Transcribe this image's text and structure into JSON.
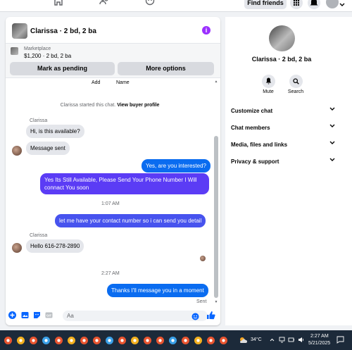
{
  "nav": {
    "find_friends": "Find friends"
  },
  "chat": {
    "title": "Clarissa · 2 bd, 2 ba",
    "info_glyph": "i",
    "listing": {
      "category": "Marketplace",
      "price_line": "$1,200 · 2 bd, 2 ba",
      "mark_pending": "Mark as pending",
      "more_options": "More options"
    },
    "cropped_labels": [
      "Add",
      "Name"
    ],
    "system_note": "Clarissa started this chat.",
    "system_link": "View buyer profile",
    "messages": [
      {
        "sender": "Clarissa",
        "text": "Hi, is this available?"
      },
      {
        "text": "Message sent"
      },
      {
        "text": "Yes, are you interested?"
      },
      {
        "text": "Yes Its Still Available, Please Send Your Phone Number I Will connact You soon"
      },
      {
        "time": "1:07 AM"
      },
      {
        "text": "let me have your contact number so i can send you detail"
      },
      {
        "sender": "Clarissa",
        "text": "Hello 616-278-2890"
      },
      {
        "time": "2:27 AM"
      },
      {
        "text": "Thanks I'll message you in a moment"
      }
    ],
    "sent_label": "Sent",
    "composer_placeholder": "Aa"
  },
  "profile": {
    "name": "Clarissa · 2 bd, 2 ba",
    "mute": "Mute",
    "search": "Search",
    "sections": [
      "Customize chat",
      "Chat members",
      "Media, files and links",
      "Privacy & support"
    ]
  },
  "taskbar": {
    "temperature": "34°C",
    "time": "2:27 AM",
    "date": "5/21/2025"
  },
  "colors": {
    "blue_bubble": "#0a6cf0",
    "purple_bubble": "#5b3cf5",
    "indigo_bubble": "#4753ee",
    "accent": "#0866ff"
  }
}
